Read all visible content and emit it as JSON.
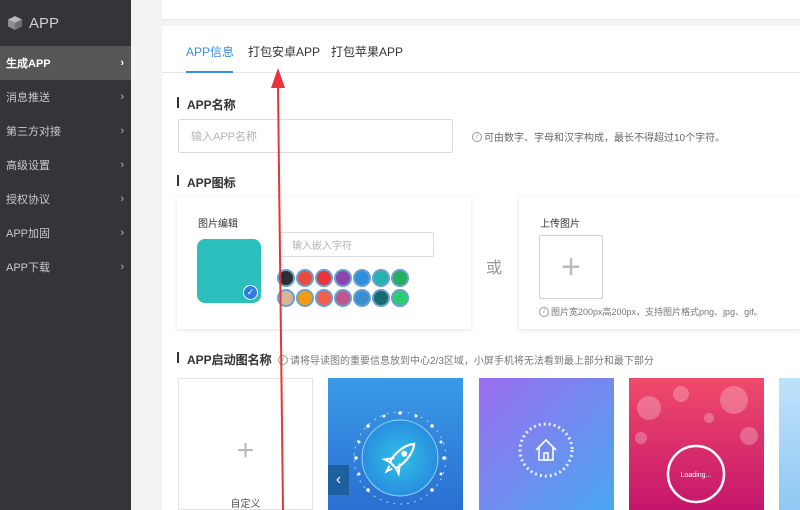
{
  "sidebar": {
    "brand": "APP",
    "items": [
      {
        "label": "生成APP",
        "active": true
      },
      {
        "label": "消息推送"
      },
      {
        "label": "第三方对接"
      },
      {
        "label": "高级设置"
      },
      {
        "label": "授权协议"
      },
      {
        "label": "APP加固"
      },
      {
        "label": "APP下载"
      }
    ]
  },
  "tabs": [
    {
      "label": "APP信息",
      "active": true
    },
    {
      "label": "打包安卓APP"
    },
    {
      "label": "打包苹果APP"
    }
  ],
  "app_name": {
    "title": "APP名称",
    "placeholder": "输入APP名称",
    "hint": "可由数字、字母和汉字构成，最长不得超过10个字符。"
  },
  "app_icon": {
    "title": "APP图标",
    "editor_label": "图片编辑",
    "embed_placeholder": "输入嵌入字符",
    "or_text": "或",
    "upload_label": "上传图片",
    "upload_hint": "图片宽200px高200px，支持图片格式png、jpg、gif。",
    "preview_color": "#2bbfbd",
    "swatches": [
      "#2d2f33",
      "#e74c3c",
      "#e8343a",
      "#8e44ad",
      "#2f8fdc",
      "#26b3b0",
      "#27ae60",
      "#d5b49a",
      "#f39c12",
      "#f0604a",
      "#c0568e",
      "#3a8fd1",
      "#176a70",
      "#2ecc71"
    ]
  },
  "splash": {
    "title": "APP启动图名称",
    "hint": "请将导读图的重要信息放到中心2/3区域，小屏手机将无法看到最上部分和最下部分",
    "custom_label": "自定义",
    "loading_text": "Loading..."
  },
  "colors": {
    "accent": "#3a8ee6",
    "sidebar_bg": "#333538",
    "annotation_arrow": "#e8333a"
  }
}
